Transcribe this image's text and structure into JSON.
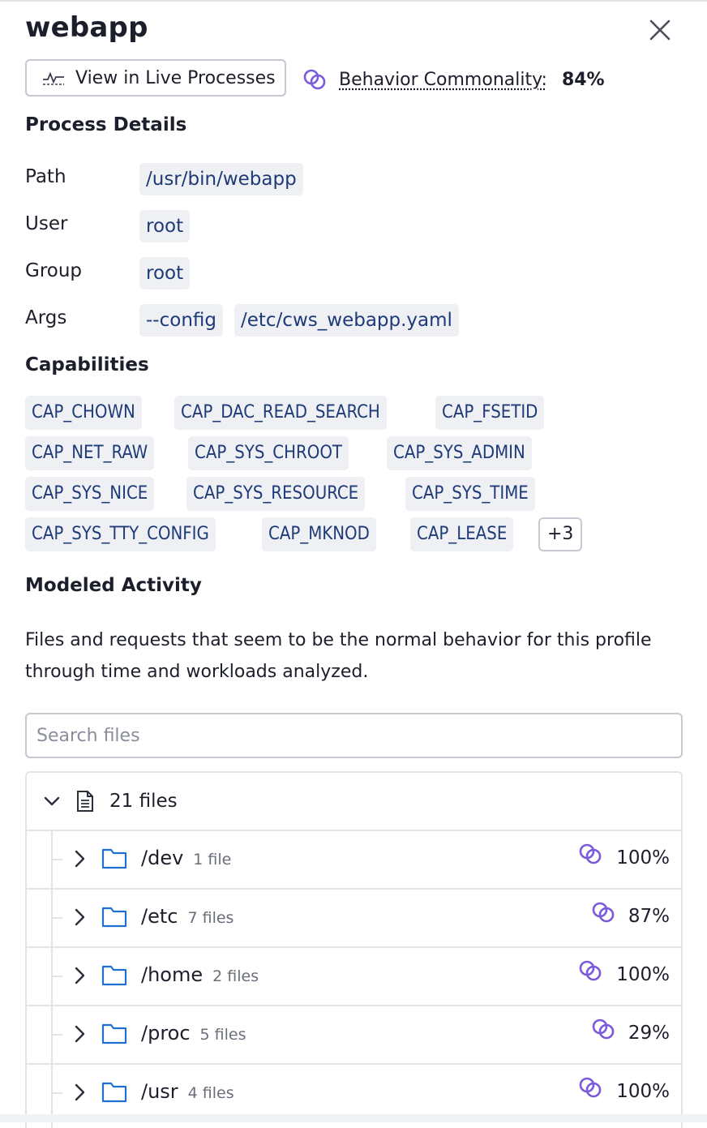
{
  "panel": {
    "title": "webapp",
    "live_button_label": "View in Live Processes",
    "commonality_label": "Behavior Commonality:",
    "commonality_value": "84%",
    "accent_color": "#7b5bdb",
    "folder_color": "#1f6fd1"
  },
  "process_details": {
    "heading": "Process Details",
    "path_label": "Path",
    "path_value": "/usr/bin/webapp",
    "user_label": "User",
    "user_value": "root",
    "group_label": "Group",
    "group_value": "root",
    "args_label": "Args",
    "args": [
      "--config",
      "/etc/cws_webapp.yaml"
    ]
  },
  "capabilities": {
    "heading": "Capabilities",
    "items": [
      "CAP_CHOWN",
      "CAP_DAC_READ_SEARCH",
      "CAP_FSETID",
      "CAP_NET_RAW",
      "CAP_SYS_CHROOT",
      "CAP_SYS_ADMIN",
      "CAP_SYS_NICE",
      "CAP_SYS_RESOURCE",
      "CAP_SYS_TIME",
      "CAP_SYS_TTY_CONFIG",
      "CAP_MKNOD",
      "CAP_LEASE"
    ],
    "more_label": "+3"
  },
  "modeled_activity": {
    "heading": "Modeled Activity",
    "description": "Files and requests that seem to be the normal behavior for this profile through time and workloads analyzed.",
    "search_placeholder": "Search files",
    "search_value": "",
    "root_label": "21 files",
    "folders": [
      {
        "name": "/dev",
        "count": "1 file",
        "commonality": "100%"
      },
      {
        "name": "/etc",
        "count": "7 files",
        "commonality": "87%"
      },
      {
        "name": "/home",
        "count": "2 files",
        "commonality": "100%"
      },
      {
        "name": "/proc",
        "count": "5 files",
        "commonality": "29%"
      },
      {
        "name": "/usr",
        "count": "4 files",
        "commonality": "100%"
      }
    ]
  }
}
